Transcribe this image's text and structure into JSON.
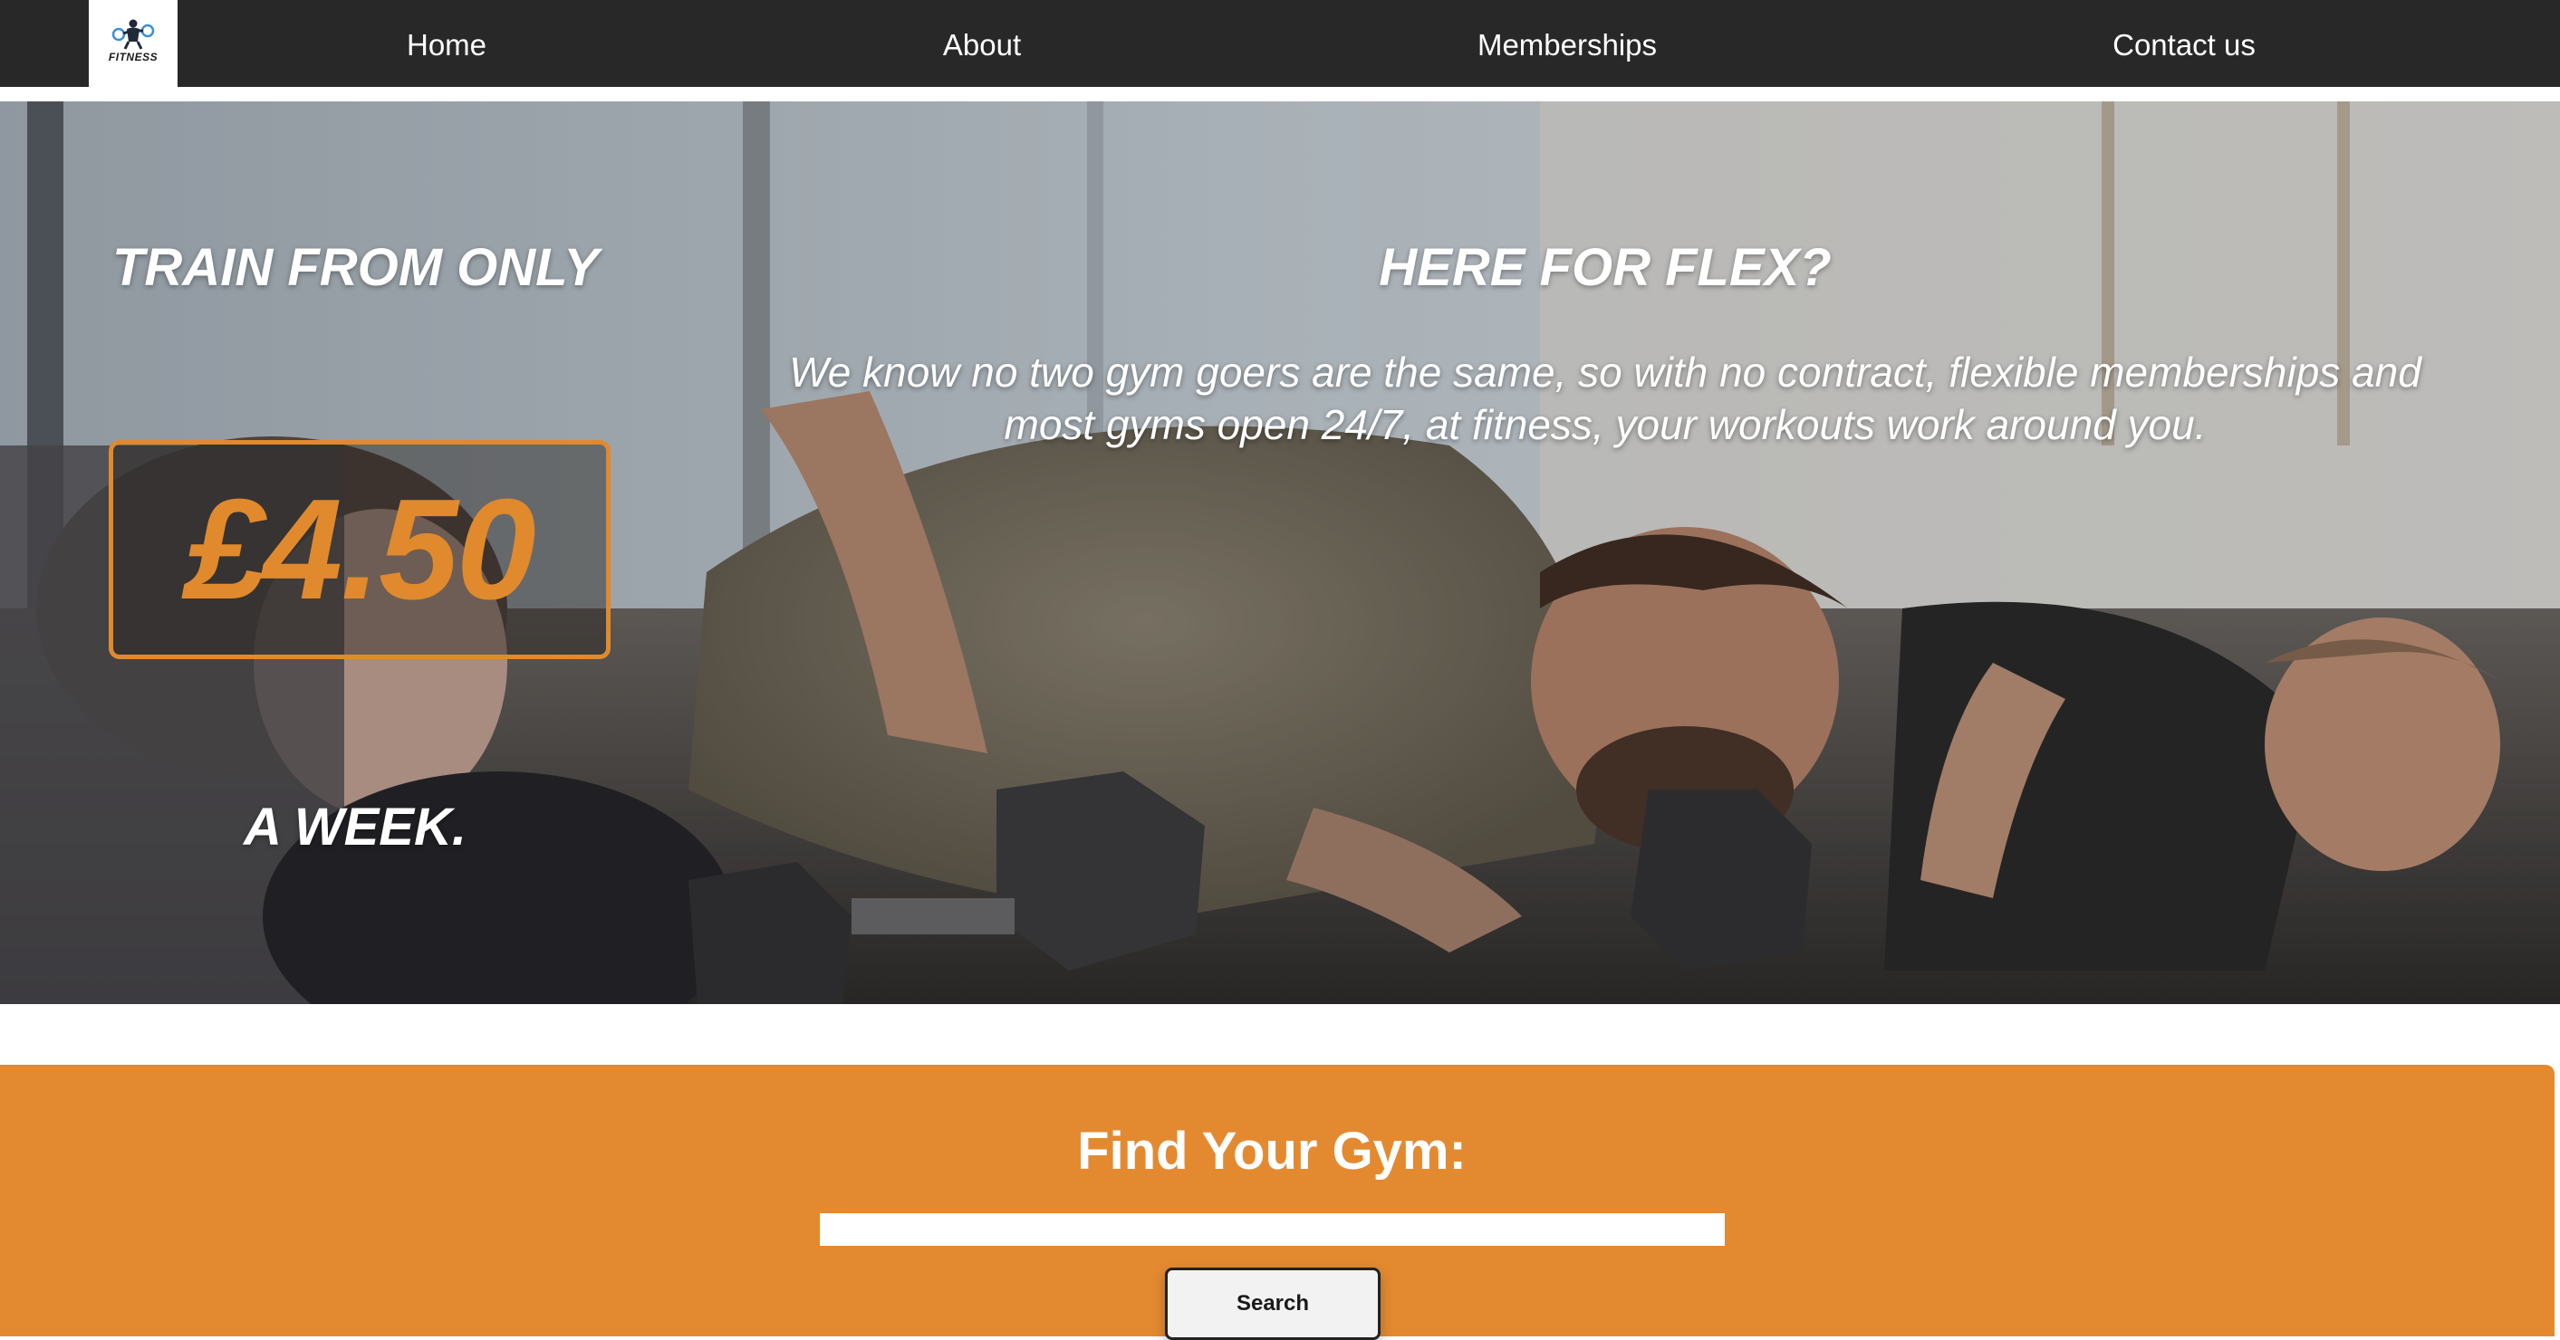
{
  "nav": {
    "logo_text": "FITNESS",
    "links": [
      {
        "label": "Home"
      },
      {
        "label": "About"
      },
      {
        "label": "Memberships"
      },
      {
        "label": "Contact us"
      }
    ]
  },
  "hero": {
    "promo_heading": "TRAIN FROM ONLY",
    "price": "£4.50",
    "price_suffix": "A WEEK.",
    "flex_heading": "HERE FOR FLEX?",
    "flex_description": "We know no two gym goers are the same, so with no contract, flexible memberships and most gyms open 24/7, at fitness, your workouts work around you."
  },
  "find_gym": {
    "title": "Find Your Gym:",
    "input_value": "",
    "search_label": "Search"
  },
  "colors": {
    "nav_bg": "#282828",
    "accent": "#e38a31",
    "text_light": "#ffffff"
  }
}
